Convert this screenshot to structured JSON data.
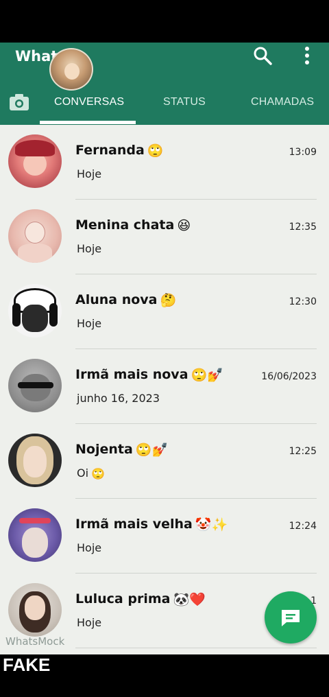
{
  "app": {
    "title": "What"
  },
  "tabs": [
    {
      "label": "CONVERSAS",
      "active": true
    },
    {
      "label": "STATUS",
      "active": false
    },
    {
      "label": "CHAMADAS",
      "active": false
    }
  ],
  "icons": {
    "camera": "camera-icon",
    "search": "search-icon",
    "menu": "more-vert-icon",
    "fab": "new-chat-icon"
  },
  "colors": {
    "appbar": "#1f7a5f",
    "fab": "#1faa62",
    "list_bg": "#eef0ec"
  },
  "chats": [
    {
      "name": "Fernanda",
      "emojis": "🙄",
      "time": "13:09",
      "preview": "Hoje"
    },
    {
      "name": "Menina chata",
      "emojis": "😆",
      "time": "12:35",
      "preview": "Hoje"
    },
    {
      "name": "Aluna nova",
      "emojis": "🤔",
      "time": "12:30",
      "preview": "Hoje"
    },
    {
      "name": "Irmã mais nova",
      "emojis": "🙄💅",
      "time": "16/06/2023",
      "preview": "junho 16, 2023"
    },
    {
      "name": "Nojenta",
      "emojis": "🙄💅",
      "time": "12:25",
      "preview": "Oi",
      "preview_emoji": "🙄"
    },
    {
      "name": "Irmã mais velha",
      "emojis": "🤡✨",
      "time": "12:24",
      "preview": "Hoje"
    },
    {
      "name": "Luluca prima",
      "emojis": "🐼❤️",
      "time": "1",
      "preview": "Hoje"
    }
  ],
  "watermark": "WhatsMock",
  "overlay_label": "FAKE"
}
